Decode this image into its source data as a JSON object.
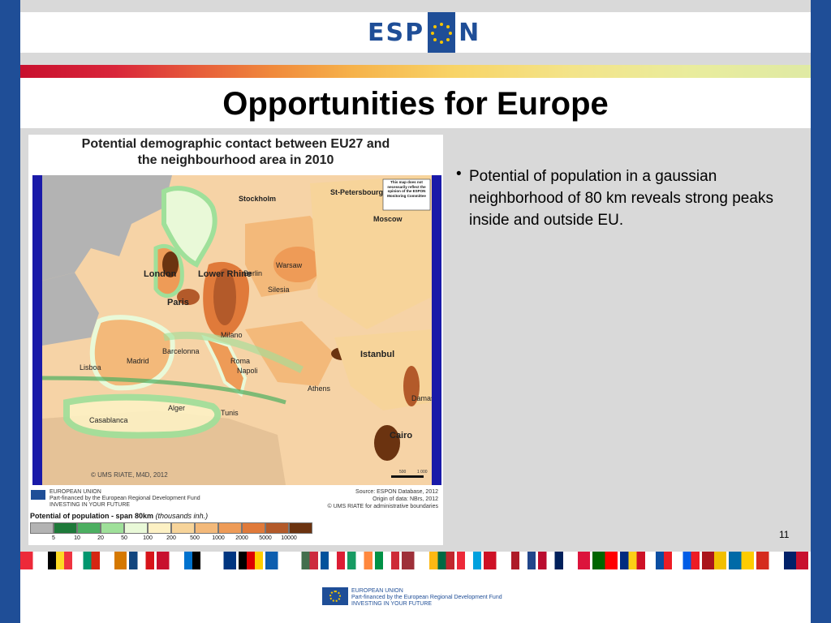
{
  "header": {
    "logo_text_left": "ESP",
    "logo_text_right": "N"
  },
  "slide": {
    "title": "Opportunities for Europe",
    "page_number": "11"
  },
  "figure": {
    "title_line1": "Potential demographic contact between EU27 and",
    "title_line2": "the neighbourhood area in 2010",
    "disclaimer": "This map does not necessarily reflect the opinion of the ESPON Monitoring Committee",
    "map_labels": {
      "stockholm": "Stockholm",
      "st_petersburg": "St-Petersbourg",
      "moscow": "Moscow",
      "london": "London",
      "lower_rhine": "Lower Rhine",
      "berlin": "Berlin",
      "warsaw": "Warsaw",
      "silesia": "Silesia",
      "paris": "Paris",
      "milano": "Milano",
      "barcelonna": "Barcelonna",
      "madrid": "Madrid",
      "lisboa": "Lisboa",
      "roma": "Roma",
      "napoli": "Napoli",
      "istanbul": "Istanbul",
      "athens": "Athens",
      "damas": "Damas",
      "alger": "Alger",
      "tunis": "Tunis",
      "casablanca": "Casablanca",
      "cairo": "Cairo"
    },
    "map_credit": "© UMS RIATE, M4D, 2012",
    "scale_label_1": "500",
    "scale_label_2": "1 000",
    "credit_left_line1": "EUROPEAN UNION",
    "credit_left_line2": "Part-financed by the European Regional Development Fund",
    "credit_left_line3": "INVESTING IN YOUR FUTURE",
    "source_line1": "Source: ESPON Database, 2012",
    "source_line2": "Origin of data: NBrs, 2012",
    "source_line3": "© UMS RIATE for administrative boundaries",
    "legend_title": "Potential of population - span 80km",
    "legend_unit": "(thousands inh.)",
    "legend_colors": [
      "#b3b3b3",
      "#1e7a3a",
      "#4caf61",
      "#9fe09a",
      "#e9f9d8",
      "#fdf1c4",
      "#f7d49a",
      "#f3b97a",
      "#ee9b57",
      "#e07a3a",
      "#b35a2a",
      "#6b3310"
    ],
    "legend_ticks": [
      "5",
      "10",
      "20",
      "50",
      "100",
      "200",
      "500",
      "1000",
      "2000",
      "5000",
      "10000"
    ]
  },
  "bullet": {
    "symbol": "•",
    "text": "Potential of population in a gaussian neighborhood of 80 km reveals strong peaks inside and outside EU."
  },
  "footer": {
    "line1": "EUROPEAN UNION",
    "line2": "Part-financed by the European Regional Development Fund",
    "line3": "INVESTING IN YOUR FUTURE"
  },
  "flag_colors": [
    [
      "#ed2939",
      "#ffffff"
    ],
    [
      "#000000",
      "#fdda24",
      "#ef3340"
    ],
    [
      "#ffffff",
      "#00966e",
      "#d62612"
    ],
    [
      "#ffffff",
      "#d57800"
    ],
    [
      "#11457e",
      "#ffffff",
      "#d7141a"
    ],
    [
      "#c8102e",
      "#ffffff"
    ],
    [
      "#0072ce",
      "#000000",
      "#ffffff"
    ],
    [
      "#ffffff",
      "#003580"
    ],
    [
      "#000000",
      "#dd0000",
      "#ffce00"
    ],
    [
      "#0d5eaf",
      "#ffffff"
    ],
    [
      "#ffffff",
      "#436f4d",
      "#cd2a3e"
    ],
    [
      "#02529c",
      "#ffffff",
      "#dc1e35"
    ],
    [
      "#169b62",
      "#ffffff",
      "#ff883e"
    ],
    [
      "#009246",
      "#ffffff",
      "#ce2b37"
    ],
    [
      "#9e3039",
      "#ffffff"
    ],
    [
      "#fdb913",
      "#006a44",
      "#c1272d"
    ],
    [
      "#ed2939",
      "#ffffff",
      "#00a1de"
    ],
    [
      "#ce1126",
      "#ffffff"
    ],
    [
      "#ae1c28",
      "#ffffff",
      "#21468b"
    ],
    [
      "#ba0c2f",
      "#ffffff",
      "#00205b"
    ],
    [
      "#ffffff",
      "#dc143c"
    ],
    [
      "#006600",
      "#ff0000"
    ],
    [
      "#002b7f",
      "#fcd116",
      "#ce1126"
    ],
    [
      "#ffffff",
      "#0b4ea2",
      "#ee1c25"
    ],
    [
      "#ffffff",
      "#005ce6",
      "#ed1c24"
    ],
    [
      "#aa151b",
      "#f1bf00"
    ],
    [
      "#006aa7",
      "#fecc00"
    ],
    [
      "#d52b1e",
      "#ffffff"
    ],
    [
      "#012169",
      "#c8102e"
    ]
  ]
}
